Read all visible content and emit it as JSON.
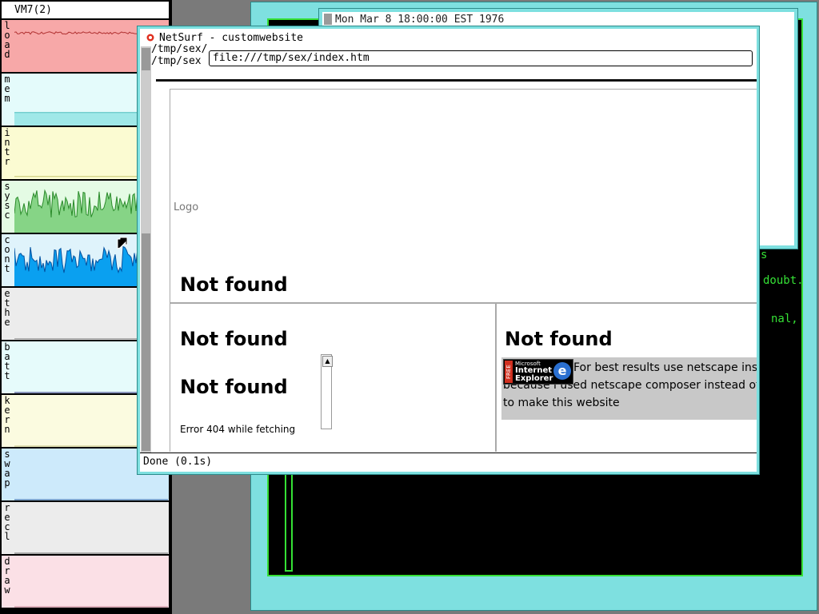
{
  "monitor": {
    "title": "VM7(2)",
    "rows": [
      {
        "label": "load",
        "bg": "#f7a8a8",
        "fill": "#f7a8a8",
        "line": "#b03030",
        "level": 0.25
      },
      {
        "label": "mem",
        "bg": "#e4fbfb",
        "fill": "#a0e8e8",
        "line": "#50c0c0",
        "level": 0.75
      },
      {
        "label": "intr",
        "bg": "#fbfbd2",
        "fill": "#fbfbd2",
        "line": "#c8c870",
        "level": 0.95
      },
      {
        "label": "sysc",
        "bg": "#e4fbe4",
        "fill": "#86d486",
        "line": "#2a8a2a",
        "level": 0.45
      },
      {
        "label": "cont",
        "bg": "#dff3fb",
        "fill": "#0aa0f0",
        "line": "#0050a0",
        "level": 0.5
      },
      {
        "label": "ethe",
        "bg": "#ececec",
        "fill": "#ececec",
        "line": "#909090",
        "level": 0.98
      },
      {
        "label": "batt",
        "bg": "#e6fbfb",
        "fill": "#e6fbfb",
        "line": "#2b2b7a",
        "level": 0.99
      },
      {
        "label": "kern",
        "bg": "#fbfbe0",
        "fill": "#fbfbe0",
        "line": "#c0c080",
        "level": 0.99
      },
      {
        "label": "swap",
        "bg": "#cdeafb",
        "fill": "#cdeafb",
        "line": "#3060a0",
        "level": 0.99
      },
      {
        "label": "recl",
        "bg": "#ececec",
        "fill": "#ececec",
        "line": "#606060",
        "level": 0.99
      },
      {
        "label": "draw",
        "bg": "#fbe0e6",
        "fill": "#fbe0e6",
        "line": "#c08090",
        "level": 0.99
      }
    ]
  },
  "clock": {
    "text": "Mon Mar  8 18:00:00 EST 1976"
  },
  "terminal": {
    "lines": [
      "s",
      "doubt.",
      "nal,"
    ]
  },
  "netsurf": {
    "title": "NetSurf - customwebsite",
    "background_lines": "/tmp/sex/\n/tmp/sex",
    "url": "file:///tmp/sex/index.htm",
    "status": "Done (0.1s)",
    "page": {
      "logo_alt": "Logo",
      "header_not_found": "Not found",
      "left_not_found_1": "Not found",
      "left_not_found_2": "Not found",
      "left_error_text": "Error 404 while fetching",
      "right_not_found": "Not found",
      "ie_badge": {
        "free": "FREE",
        "line1": "Microsoft",
        "line2": "Internet",
        "line3": "Explorer",
        "logo_letter": "e"
      },
      "ie_text_1": "For best results use netscape inst",
      "ie_text_2": "because i used netscape composer instead of",
      "ie_text_3": "to make this website"
    }
  }
}
